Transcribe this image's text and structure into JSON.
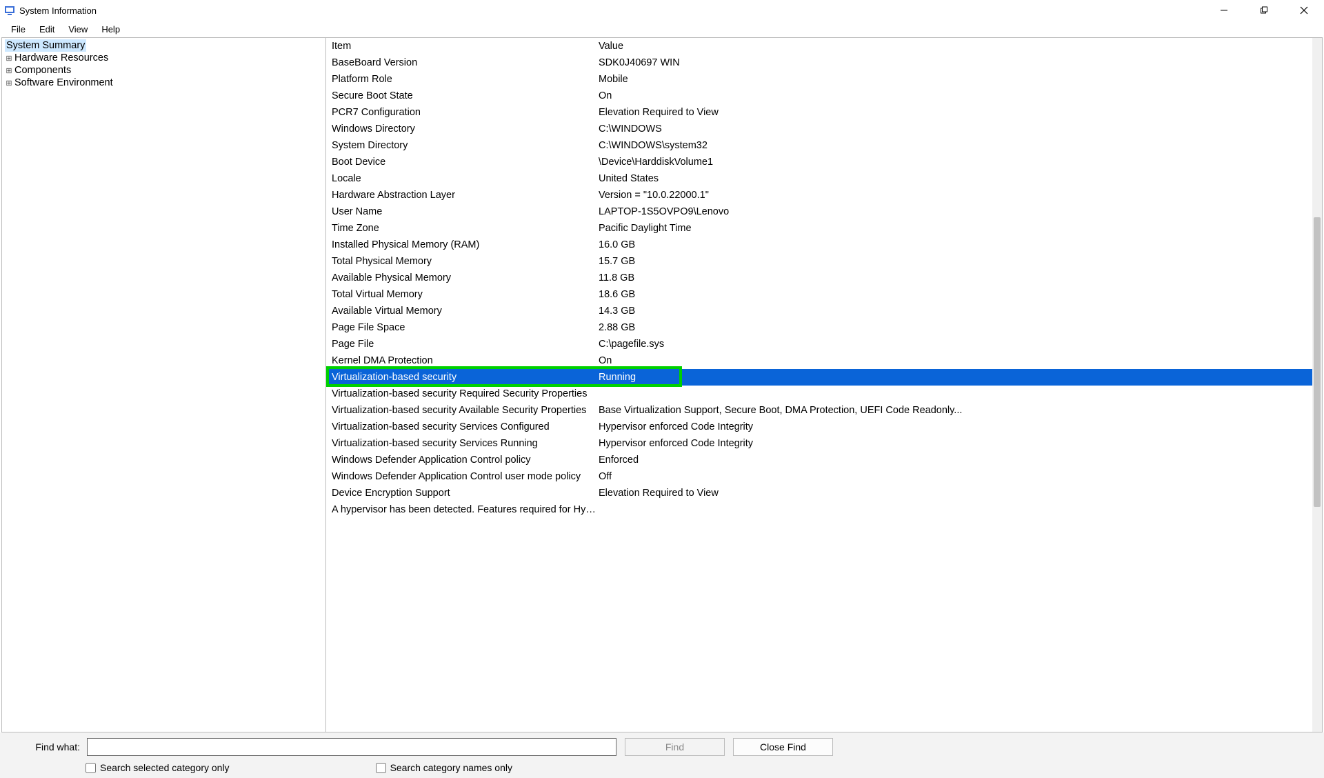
{
  "window": {
    "title": "System Information"
  },
  "menu": {
    "file": "File",
    "edit": "Edit",
    "view": "View",
    "help": "Help"
  },
  "tree": {
    "root": "System Summary",
    "items": [
      "Hardware Resources",
      "Components",
      "Software Environment"
    ]
  },
  "columns": {
    "item": "Item",
    "value": "Value"
  },
  "rows": [
    {
      "item": "BaseBoard Version",
      "value": "SDK0J40697 WIN"
    },
    {
      "item": "Platform Role",
      "value": "Mobile"
    },
    {
      "item": "Secure Boot State",
      "value": "On"
    },
    {
      "item": "PCR7 Configuration",
      "value": "Elevation Required to View"
    },
    {
      "item": "Windows Directory",
      "value": "C:\\WINDOWS"
    },
    {
      "item": "System Directory",
      "value": "C:\\WINDOWS\\system32"
    },
    {
      "item": "Boot Device",
      "value": "\\Device\\HarddiskVolume1"
    },
    {
      "item": "Locale",
      "value": "United States"
    },
    {
      "item": "Hardware Abstraction Layer",
      "value": "Version = \"10.0.22000.1\""
    },
    {
      "item": "User Name",
      "value": "LAPTOP-1S5OVPO9\\Lenovo"
    },
    {
      "item": "Time Zone",
      "value": "Pacific Daylight Time"
    },
    {
      "item": "Installed Physical Memory (RAM)",
      "value": "16.0 GB"
    },
    {
      "item": "Total Physical Memory",
      "value": "15.7 GB"
    },
    {
      "item": "Available Physical Memory",
      "value": "11.8 GB"
    },
    {
      "item": "Total Virtual Memory",
      "value": "18.6 GB"
    },
    {
      "item": "Available Virtual Memory",
      "value": "14.3 GB"
    },
    {
      "item": "Page File Space",
      "value": "2.88 GB"
    },
    {
      "item": "Page File",
      "value": "C:\\pagefile.sys"
    },
    {
      "item": "Kernel DMA Protection",
      "value": "On"
    },
    {
      "item": "Virtualization-based security",
      "value": "Running",
      "selected": true,
      "highlighted": true
    },
    {
      "item": "Virtualization-based security Required Security Properties",
      "value": ""
    },
    {
      "item": "Virtualization-based security Available Security Properties",
      "value": "Base Virtualization Support, Secure Boot, DMA Protection, UEFI Code Readonly..."
    },
    {
      "item": "Virtualization-based security Services Configured",
      "value": "Hypervisor enforced Code Integrity"
    },
    {
      "item": "Virtualization-based security Services Running",
      "value": "Hypervisor enforced Code Integrity"
    },
    {
      "item": "Windows Defender Application Control policy",
      "value": "Enforced"
    },
    {
      "item": "Windows Defender Application Control user mode policy",
      "value": "Off"
    },
    {
      "item": "Device Encryption Support",
      "value": "Elevation Required to View"
    },
    {
      "item": "A hypervisor has been detected. Features required for Hyp...",
      "value": ""
    }
  ],
  "find": {
    "label": "Find what:",
    "value": "",
    "find_btn": "Find",
    "close_btn": "Close Find",
    "chk_selected": "Search selected category only",
    "chk_names": "Search category names only"
  }
}
